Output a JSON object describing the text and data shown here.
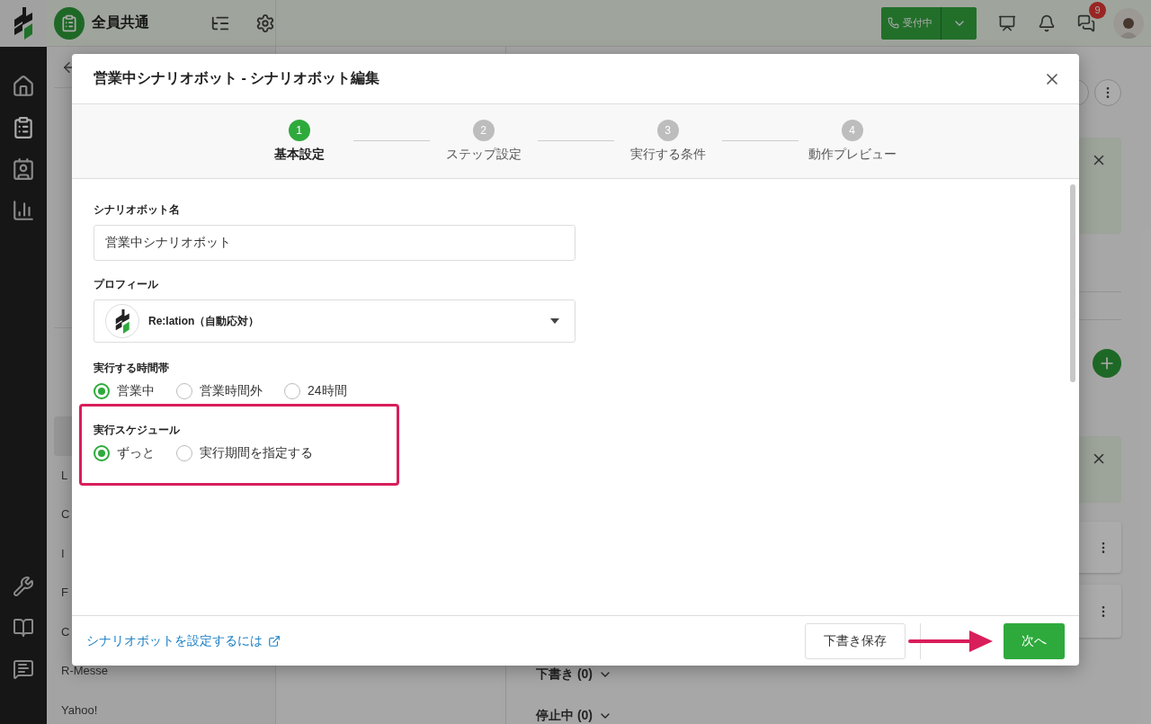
{
  "header": {
    "workspace": "全員共通",
    "status_button": "受付中",
    "chat_badge": "9"
  },
  "sidebar": {
    "items": [
      {
        "kind": "heading"
      },
      {
        "kind": "item",
        "selected": false
      },
      {
        "kind": "item",
        "selected": false
      },
      {
        "kind": "item",
        "selected": false
      },
      {
        "kind": "item",
        "selected": false
      },
      {
        "kind": "item",
        "selected": false
      },
      {
        "kind": "heading"
      },
      {
        "kind": "item",
        "selected": false
      },
      {
        "kind": "item",
        "selected": true
      },
      {
        "kind": "item",
        "label": "L",
        "selected": false
      },
      {
        "kind": "item",
        "label": "C",
        "selected": false
      },
      {
        "kind": "item",
        "label": "I",
        "selected": false
      },
      {
        "kind": "item",
        "label": "F",
        "selected": false
      },
      {
        "kind": "item",
        "label": "C",
        "selected": false
      },
      {
        "kind": "item",
        "label": "R-Messe",
        "selected": false
      },
      {
        "kind": "item",
        "label": "Yahoo!",
        "selected": false
      }
    ]
  },
  "main": {
    "sections": [
      {
        "label": "下書き (0)",
        "expanded": false
      },
      {
        "label": "停止中 (0)",
        "expanded": false
      }
    ]
  },
  "modal": {
    "title": "営業中シナリオボット - シナリオボット編集",
    "steps": [
      {
        "number": "1",
        "label": "基本設定",
        "selected": true
      },
      {
        "number": "2",
        "label": "ステップ設定",
        "selected": false
      },
      {
        "number": "3",
        "label": "実行する条件",
        "selected": false
      },
      {
        "number": "4",
        "label": "動作プレビュー",
        "selected": false
      }
    ],
    "name_field": {
      "label": "シナリオボット名",
      "value": "営業中シナリオボット"
    },
    "profile": {
      "label": "プロフィール",
      "value": "Re:lation（自動応対）"
    },
    "time_band": {
      "label": "実行する時間帯",
      "options": [
        {
          "label": "営業中",
          "selected": true
        },
        {
          "label": "営業時間外",
          "selected": false
        },
        {
          "label": "24時間",
          "selected": false
        }
      ]
    },
    "schedule": {
      "label": "実行スケジュール",
      "options": [
        {
          "label": "ずっと",
          "selected": true
        },
        {
          "label": "実行期間を指定する",
          "selected": false
        }
      ]
    },
    "help_link": "シナリオボットを設定するには",
    "draft_button": "下書き保存",
    "next_button": "次へ"
  }
}
